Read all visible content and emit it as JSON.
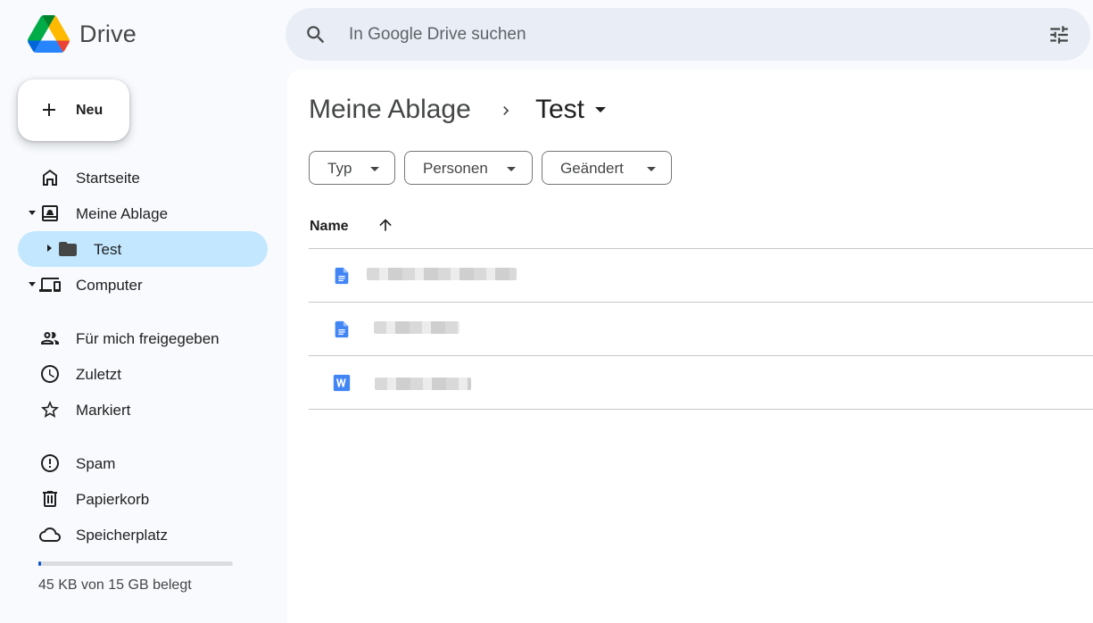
{
  "app": {
    "name": "Drive"
  },
  "search": {
    "placeholder": "In Google Drive suchen"
  },
  "new_button": {
    "label": "Neu"
  },
  "sidebar": {
    "items": [
      {
        "label": "Startseite",
        "icon": "home-icon"
      },
      {
        "label": "Meine Ablage",
        "icon": "my-drive-icon"
      },
      {
        "label": "Test",
        "icon": "folder-icon"
      },
      {
        "label": "Computer",
        "icon": "computer-icon"
      },
      {
        "label": "Für mich freigegeben",
        "icon": "shared-icon"
      },
      {
        "label": "Zuletzt",
        "icon": "clock-icon"
      },
      {
        "label": "Markiert",
        "icon": "star-icon"
      },
      {
        "label": "Spam",
        "icon": "spam-icon"
      },
      {
        "label": "Papierkorb",
        "icon": "trash-icon"
      },
      {
        "label": "Speicherplatz",
        "icon": "cloud-icon"
      }
    ]
  },
  "storage": {
    "text": "45 KB von 15 GB belegt",
    "used_fraction": 0.003
  },
  "breadcrumb": {
    "parent": "Meine Ablage",
    "current": "Test"
  },
  "filters": {
    "type": "Typ",
    "people": "Personen",
    "modified": "Geändert"
  },
  "table": {
    "name_header": "Name",
    "files": [
      {
        "kind": "google-doc",
        "name": ""
      },
      {
        "kind": "google-doc",
        "name": ""
      },
      {
        "kind": "word-doc",
        "name": ""
      }
    ]
  },
  "colors": {
    "accent": "#0b57d0",
    "active_nav": "#c2e7ff",
    "background": "#f8fafd"
  }
}
